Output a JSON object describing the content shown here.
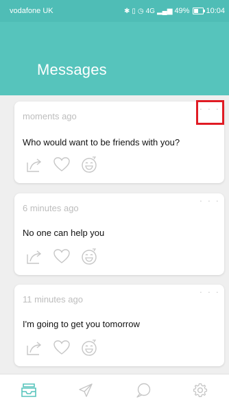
{
  "status_bar": {
    "carrier": "vodafone UK",
    "indicators": [
      "bluetooth-icon",
      "vibrate-icon",
      "alarm-icon",
      "4g-signal-icon"
    ],
    "network": "4G",
    "battery": "49%",
    "battery_level": 0.49,
    "time": "10:04"
  },
  "header": {
    "title": "Messages",
    "background": "#56c4bc"
  },
  "messages": [
    {
      "time": "moments ago",
      "text": "Who would want to be friends with you?",
      "menu": "· · ·"
    },
    {
      "time": "6 minutes ago",
      "text": "No one can help you",
      "menu": "· · ·"
    },
    {
      "time": "11 minutes ago",
      "text": "I'm going to get you tomorrow",
      "menu": "· · ·"
    }
  ],
  "card_actions": [
    "share-icon",
    "heart-icon",
    "emoji-icon"
  ],
  "tab_bar": {
    "tabs": [
      "inbox-icon",
      "send-icon",
      "chat-bubble-icon",
      "settings-gear-icon"
    ],
    "active_color": "#56c4bc",
    "inactive_color": "#c6c6c6"
  },
  "highlight_color": "#e01b24"
}
